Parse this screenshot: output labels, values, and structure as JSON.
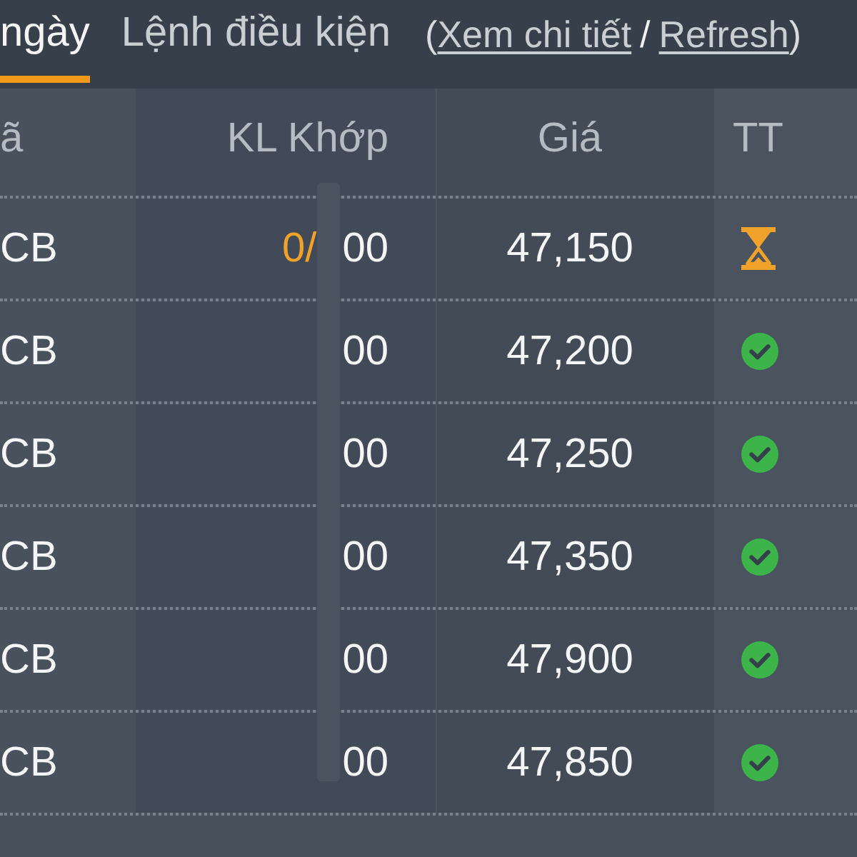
{
  "tabs": [
    {
      "label": "ngày",
      "selected": true
    },
    {
      "label": "Lệnh điều kiện",
      "selected": false
    }
  ],
  "links": {
    "open": "(",
    "items": [
      {
        "label": "Xem chi tiết"
      },
      {
        "label": "Refresh"
      }
    ],
    "separator": "/",
    "close": ")"
  },
  "table": {
    "columns": [
      {
        "label": "ã"
      },
      {
        "label": "KL Khớp"
      },
      {
        "label": "Giá"
      },
      {
        "label": "TT"
      }
    ],
    "rows": [
      {
        "code": "CB",
        "volume_start": "0/",
        "volume_end": "00",
        "price": "47,150",
        "matched": false
      },
      {
        "code": "CB",
        "volume_end": "00",
        "price": "47,200",
        "matched": true
      },
      {
        "code": "CB",
        "volume_end": "00",
        "price": "47,250",
        "matched": true
      },
      {
        "code": "CB",
        "volume_end": "00",
        "price": "47,350",
        "matched": true
      },
      {
        "code": "CB",
        "volume_end": "00",
        "price": "47,900",
        "matched": true
      },
      {
        "code": "CB",
        "volume_end": "00",
        "price": "47,850",
        "matched": true
      }
    ]
  }
}
